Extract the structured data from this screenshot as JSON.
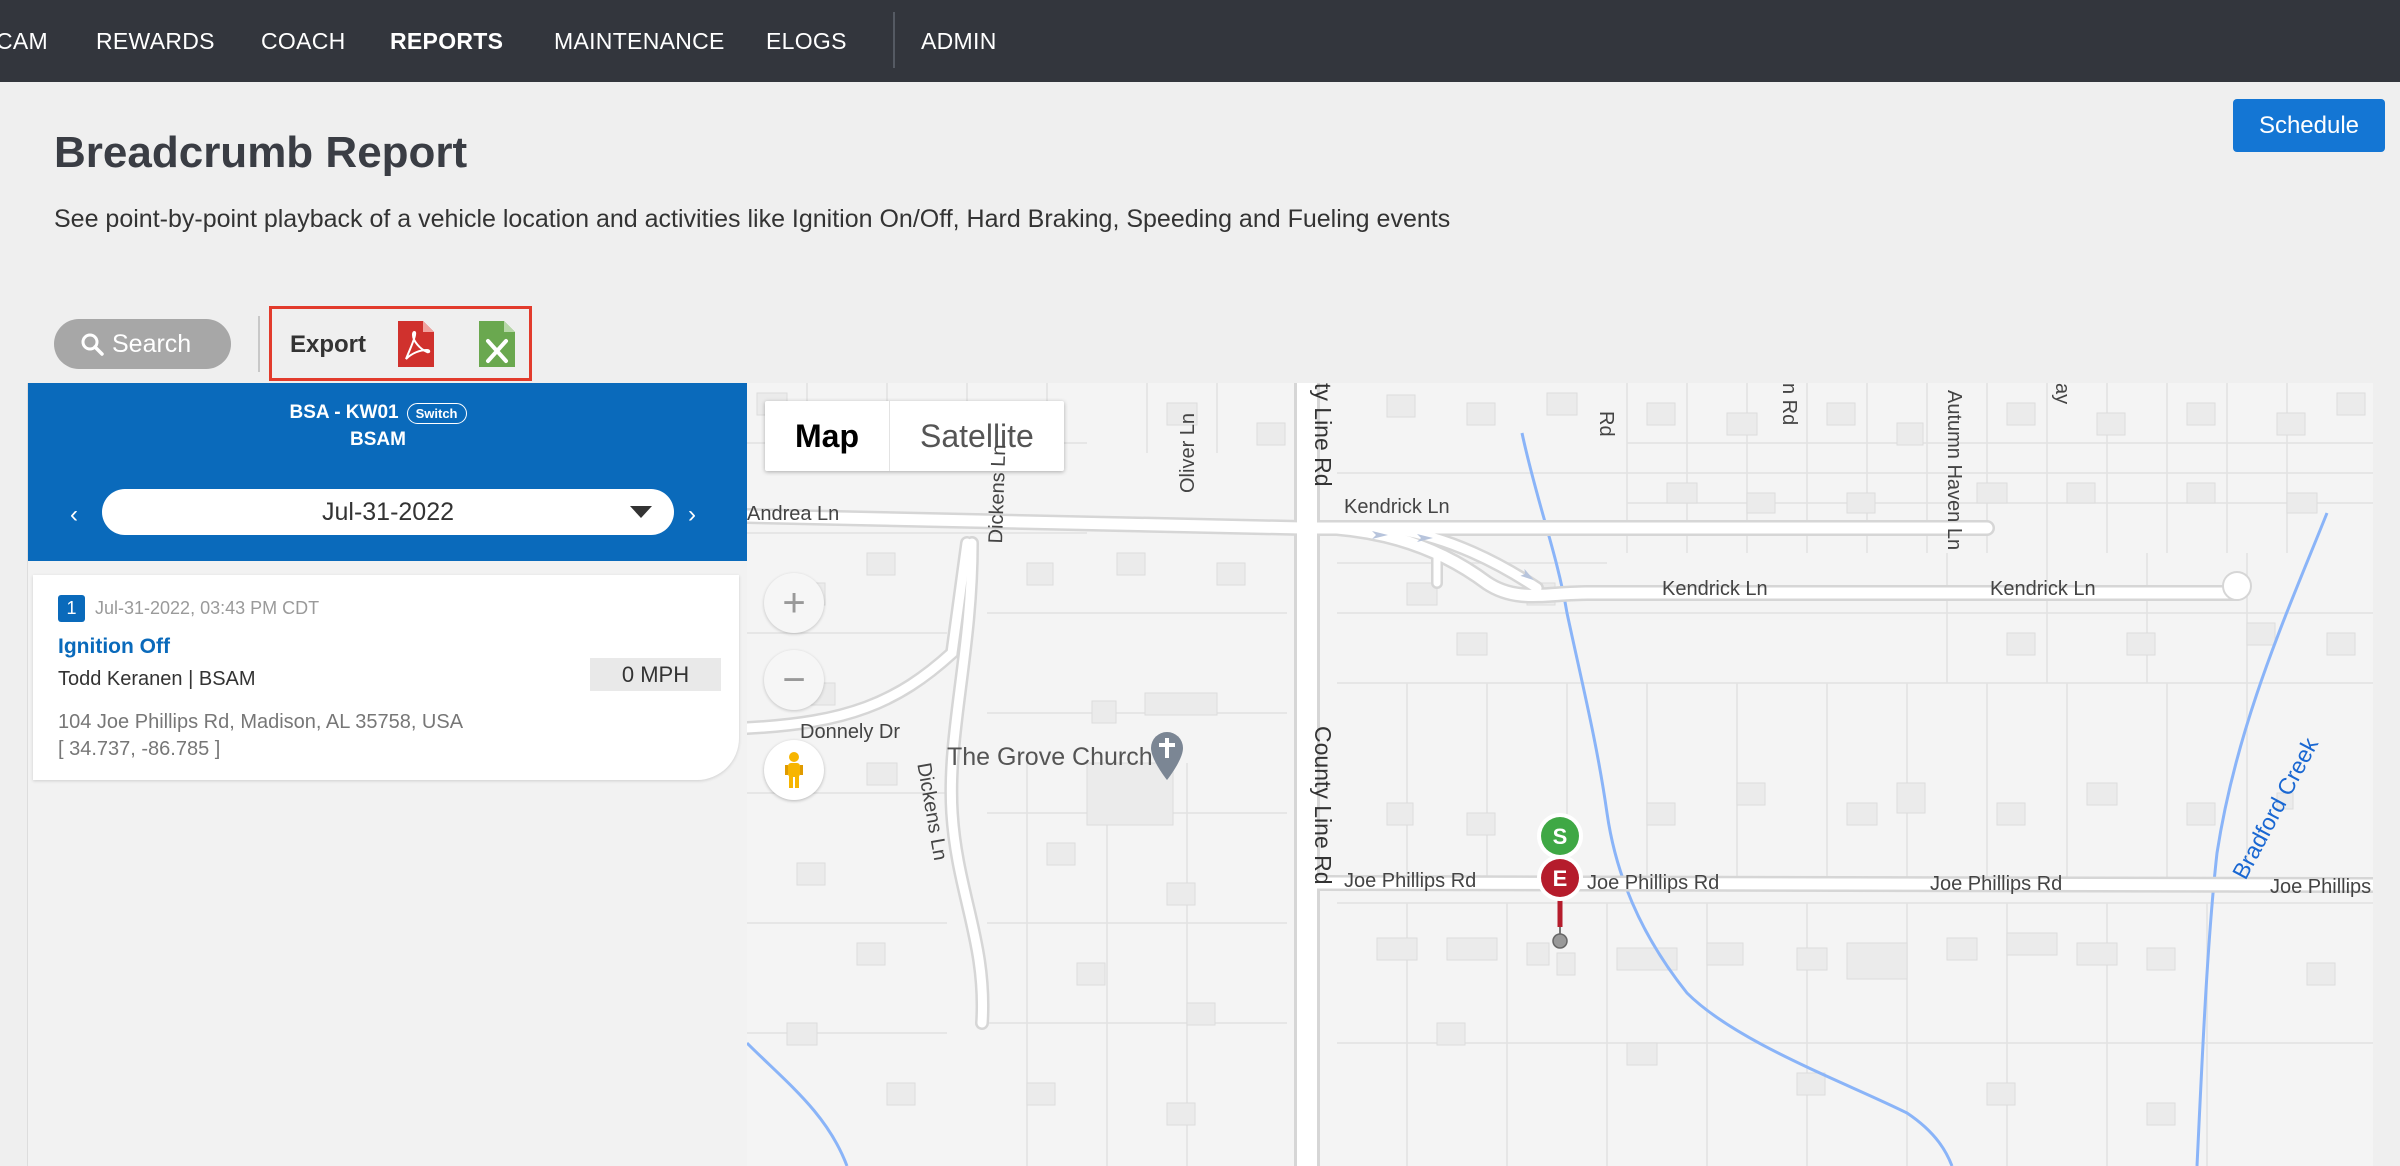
{
  "nav": {
    "items": [
      "CAM",
      "REWARDS",
      "COACH",
      "REPORTS",
      "MAINTENANCE",
      "ELOGS",
      "ADMIN"
    ],
    "active": "REPORTS"
  },
  "header": {
    "title": "Breadcrumb Report",
    "description": "See point-by-point playback of a vehicle location and activities like Ignition On/Off, Hard Braking, Speeding and Fueling events",
    "schedule_label": "Schedule"
  },
  "toolbar": {
    "search_label": "Search",
    "export_label": "Export",
    "export_icons": [
      "pdf-file-icon",
      "excel-file-icon"
    ]
  },
  "panel": {
    "vehicle": "BSA - KW01",
    "switch_label": "Switch",
    "group": "BSAM",
    "date": "Jul-31-2022",
    "prev_glyph": "‹",
    "next_glyph": "›"
  },
  "event": {
    "number": "1",
    "timestamp": "Jul-31-2022, 03:43 PM CDT",
    "type": "Ignition Off",
    "driver": "Todd Keranen | BSAM",
    "speed": "0 MPH",
    "address": "104 Joe Phillips Rd, Madison, AL 35758, USA",
    "coords": "[ 34.737, -86.785 ]"
  },
  "map": {
    "type_options": [
      "Map",
      "Satellite"
    ],
    "selected_type": "Map",
    "zoom_in": "+",
    "zoom_out": "−",
    "poi": "The Grove Church",
    "streets": {
      "andrea": "Andrea Ln",
      "kendrick1": "Kendrick Ln",
      "kendrick2": "Kendrick Ln",
      "kendrick3": "Kendrick Ln",
      "donnely": "Donnely Dr",
      "joe1": "Joe Phillips Rd",
      "joe2": "Joe Phillips Rd",
      "joe3": "Joe Phillips Rd",
      "joe4": "Joe Phillips",
      "county_top": "ty Line Rd",
      "county_mid": "County Line Rd",
      "dickens1": "Dickens Ln",
      "dickens2": "Dickens Ln",
      "oliver": "Oliver Ln",
      "rd_a": "Rd",
      "rd_b": "n Rd",
      "autumn": "Autumn Haven Ln",
      "ay": "ay",
      "creek": "Bradford Creek"
    },
    "start_marker": "S",
    "end_marker": "E",
    "colors": {
      "start": "#3fa845",
      "end": "#b51c2c",
      "water": "#8ab4f8",
      "creek_label": "#1967d2"
    }
  }
}
